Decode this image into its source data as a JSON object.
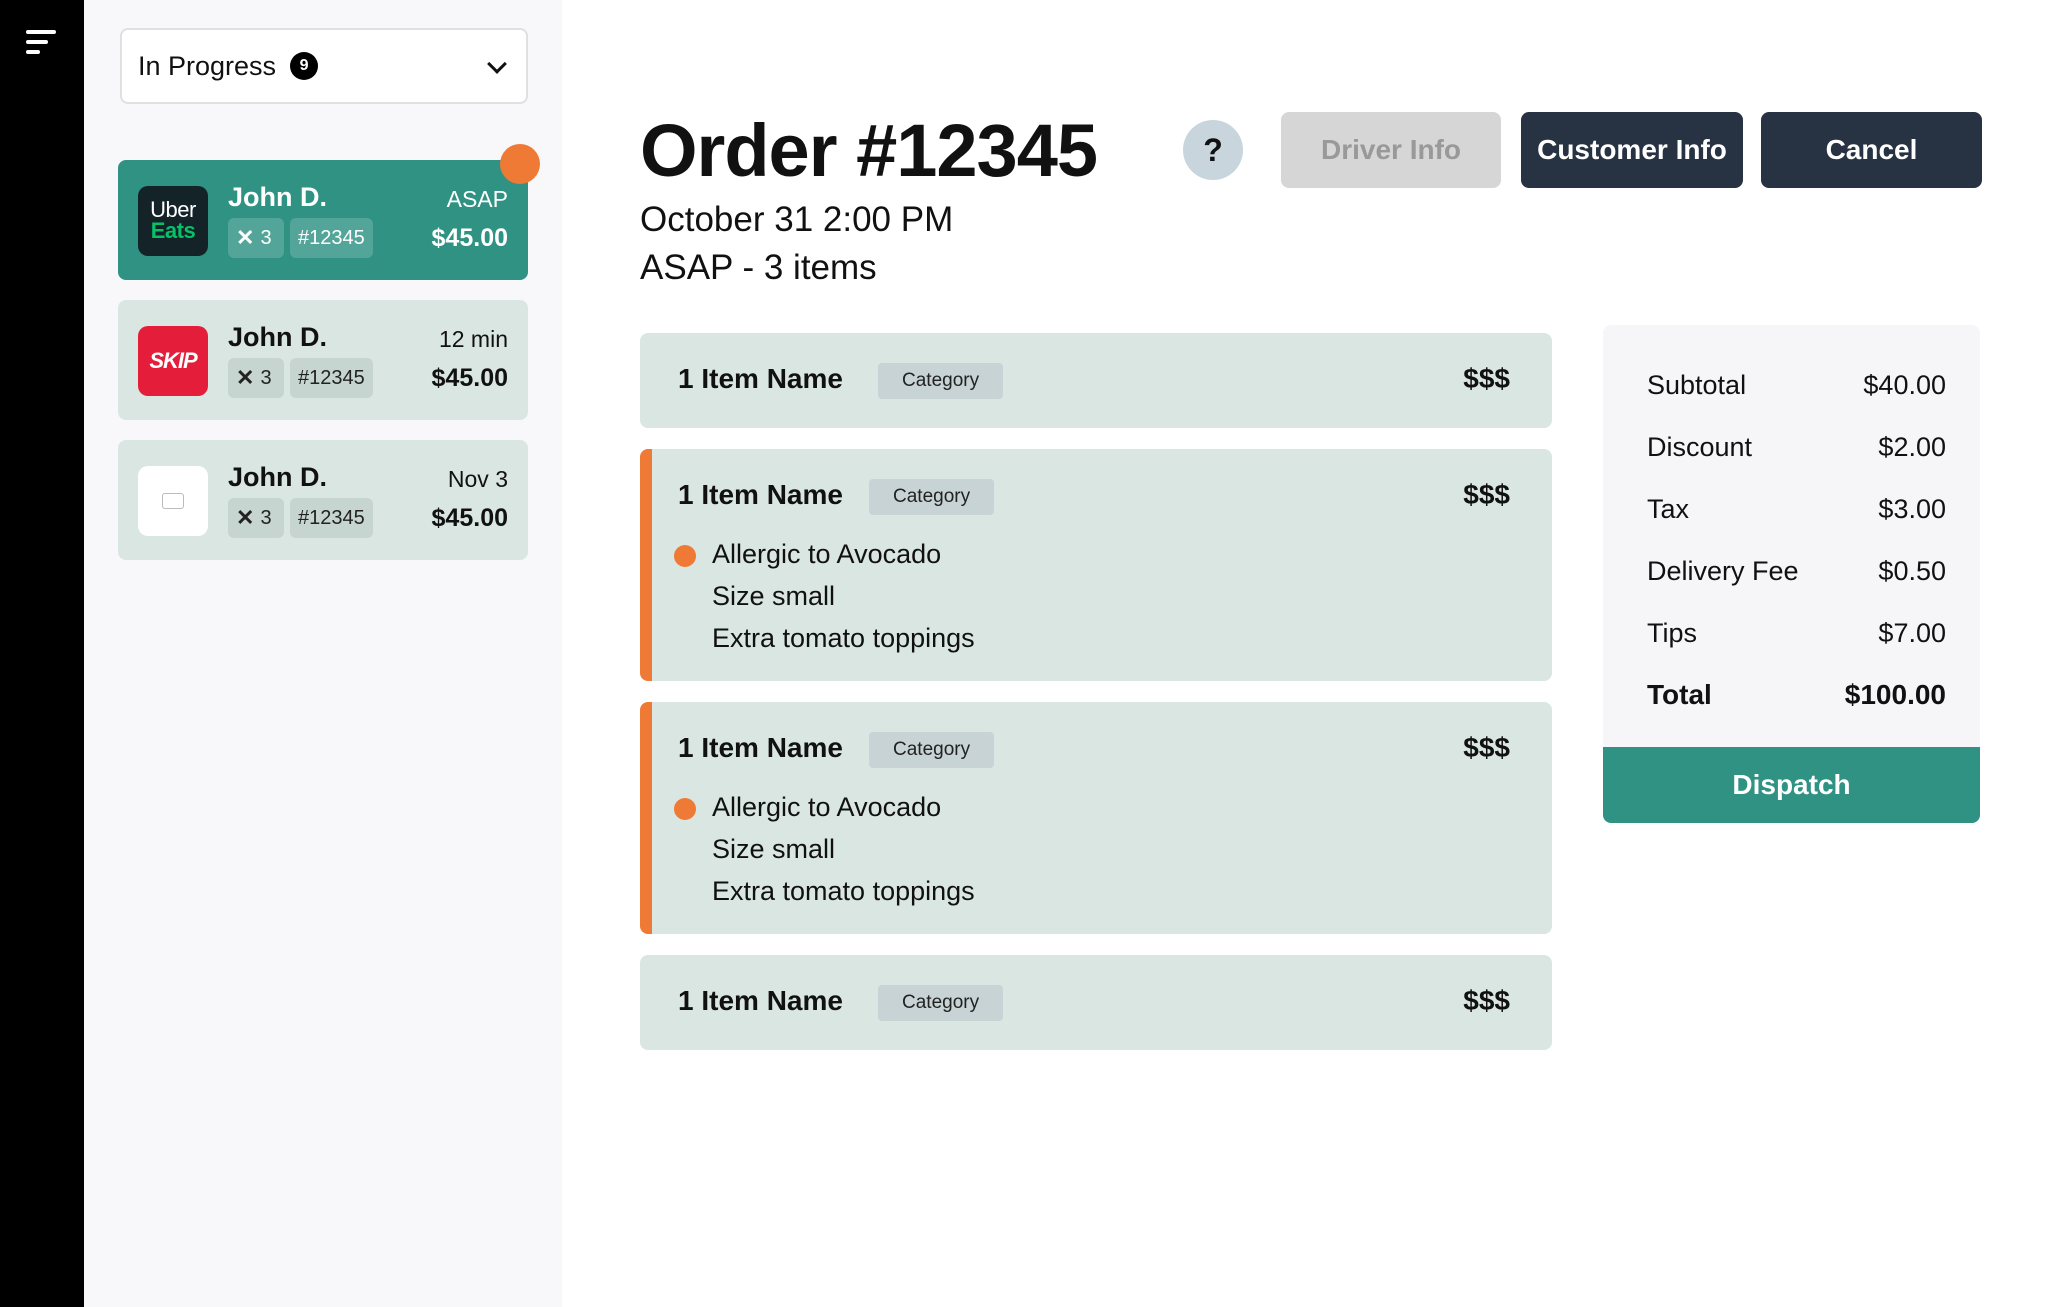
{
  "sidebar_filter": {
    "label": "In Progress",
    "count": "9"
  },
  "orders": [
    {
      "provider": "uber-eats",
      "logo_line1": "Uber",
      "logo_line2": "Eats",
      "name": "John D.",
      "time": "ASAP",
      "qty": "3",
      "number": "#12345",
      "total": "$45.00",
      "active": true,
      "has_notification": true
    },
    {
      "provider": "skip",
      "logo_text": "SKIP",
      "name": "John D.",
      "time": "12 min",
      "qty": "3",
      "number": "#12345",
      "total": "$45.00",
      "active": false
    },
    {
      "provider": "doordash",
      "name": "John D.",
      "time": "Nov 3",
      "qty": "3",
      "number": "#12345",
      "total": "$45.00",
      "active": false
    }
  ],
  "order": {
    "title": "Order #12345",
    "date": "October 31 2:00 PM",
    "meta": "ASAP - 3 items"
  },
  "header_buttons": {
    "help": "?",
    "driver": "Driver Info",
    "customer": "Customer Info",
    "cancel": "Cancel"
  },
  "items": [
    {
      "name": "1 Item Name",
      "category": "Category",
      "price": "$$$"
    },
    {
      "name": "1 Item Name",
      "category": "Category",
      "price": "$$$",
      "mods": [
        "Allergic to Avocado",
        "Size small",
        "Extra tomato toppings"
      ]
    },
    {
      "name": "1 Item Name",
      "category": "Category",
      "price": "$$$",
      "mods": [
        "Allergic to Avocado",
        "Size small",
        "Extra tomato toppings"
      ]
    },
    {
      "name": "1 Item Name",
      "category": "Category",
      "price": "$$$"
    }
  ],
  "summary": {
    "rows": [
      {
        "label": "Subtotal",
        "value": "$40.00"
      },
      {
        "label": "Discount",
        "value": "$2.00"
      },
      {
        "label": "Tax",
        "value": "$3.00"
      },
      {
        "label": "Delivery Fee",
        "value": "$0.50"
      },
      {
        "label": "Tips",
        "value": "$7.00"
      }
    ],
    "total_label": "Total",
    "total_value": "$100.00",
    "dispatch_label": "Dispatch"
  },
  "colors": {
    "accent": "#2f9283",
    "warning": "#ef7a35",
    "dark": "#273242",
    "card": "#dae6e2"
  },
  "icons": [
    "menu-icon",
    "chevron-down-icon",
    "close-icon",
    "help-icon"
  ]
}
